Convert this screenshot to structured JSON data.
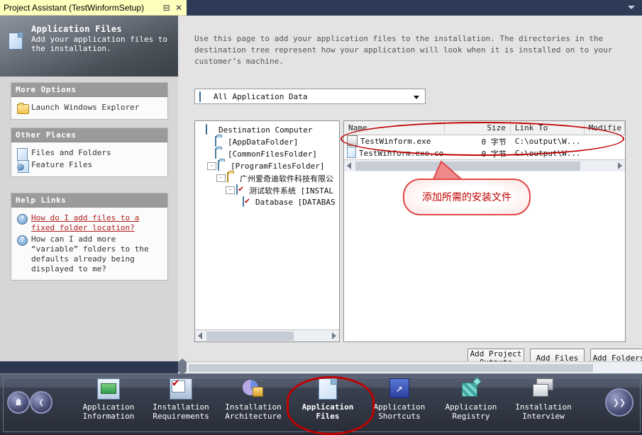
{
  "window": {
    "title": "Project Assistant (TestWinformSetup)",
    "pin_label": "⊟",
    "close_label": "✕"
  },
  "page_header": {
    "title": "Application Files",
    "subtitle": "Add your application files to the installation.",
    "icon": "document-icon"
  },
  "sidebar": {
    "panels": [
      {
        "title": "More Options",
        "items": [
          {
            "label": "Launch Windows Explorer",
            "icon": "folder-explorer-icon"
          }
        ]
      },
      {
        "title": "Other Places",
        "items": [
          {
            "label": "Files and Folders",
            "icon": "file-folder-icon"
          },
          {
            "label": "Feature Files",
            "icon": "feature-file-icon"
          }
        ]
      },
      {
        "title": "Help Links",
        "items": [
          {
            "label": "How do I add files to a fixed folder location?",
            "icon": "question-icon",
            "link": true
          },
          {
            "label": "How can I add more “variable” folders to the defaults already being displayed to me?",
            "icon": "question-icon",
            "link": false
          }
        ]
      }
    ]
  },
  "main": {
    "intro": "Use this page to add your application files to the installation. The directories in the destination tree represent how your application will look when it is installed on to your customer’s machine.",
    "filter_combo": {
      "value": "All Application Data",
      "icon": "computer-icon"
    },
    "tree": {
      "nodes": [
        {
          "label": "Destination Computer",
          "indent": 0,
          "icon": "computer-icon",
          "expander": ""
        },
        {
          "label": "[AppDataFolder]",
          "indent": 1,
          "icon": "folder-icon",
          "expander": ""
        },
        {
          "label": "[CommonFilesFolder]",
          "indent": 1,
          "icon": "folder-icon",
          "expander": ""
        },
        {
          "label": "[ProgramFilesFolder]",
          "indent": 1,
          "icon": "folder-icon",
          "expander": "-"
        },
        {
          "label": "广州爱奇迪软件科技有限公",
          "indent": 2,
          "icon": "folder-open-icon",
          "expander": "-"
        },
        {
          "label": "测试软件系统  [INSTAL",
          "indent": 3,
          "icon": "checked-folder-icon",
          "expander": "-"
        },
        {
          "label": "Database  [DATABAS",
          "indent": 4,
          "icon": "checked-folder-icon",
          "expander": ""
        }
      ]
    },
    "file_list": {
      "columns": [
        "Name",
        "Size",
        "Link To",
        "Modifie"
      ],
      "rows": [
        {
          "name": "TestWinform.exe",
          "size": "0 字节",
          "link_to": "C:\\output\\W...",
          "modified": "",
          "icon": "exe-icon"
        },
        {
          "name": "TestWinform.exe.co...",
          "size": "0 字节",
          "link_to": "C:\\output\\W...",
          "modified": "",
          "icon": "config-file-icon"
        }
      ]
    },
    "buttons": [
      {
        "id": "add-project-outputs",
        "label": "Add Project Outputs"
      },
      {
        "id": "add-files",
        "label": "Add Files"
      },
      {
        "id": "add-folders",
        "label": "Add Folders"
      }
    ]
  },
  "annotation": {
    "callout_text": "添加所需的安装文件",
    "highlight_color": "#c00000"
  },
  "bottom_nav": {
    "home_icon": "home-icon",
    "back_icon": "back-arrow-icon",
    "next_icon": "next-arrow-icon",
    "items": [
      {
        "line1": "Application",
        "line2": "Information",
        "icon": "application-information-icon",
        "active": false
      },
      {
        "line1": "Installation",
        "line2": "Requirements",
        "icon": "installation-requirements-icon",
        "active": false
      },
      {
        "line1": "Installation",
        "line2": "Architecture",
        "icon": "installation-architecture-icon",
        "active": false
      },
      {
        "line1": "Application",
        "line2": "Files",
        "icon": "application-files-icon",
        "active": true
      },
      {
        "line1": "Application",
        "line2": "Shortcuts",
        "icon": "application-shortcuts-icon",
        "active": false
      },
      {
        "line1": "Application",
        "line2": "Registry",
        "icon": "application-registry-icon",
        "active": false
      },
      {
        "line1": "Installation",
        "line2": "Interview",
        "icon": "installation-interview-icon",
        "active": false
      }
    ]
  }
}
